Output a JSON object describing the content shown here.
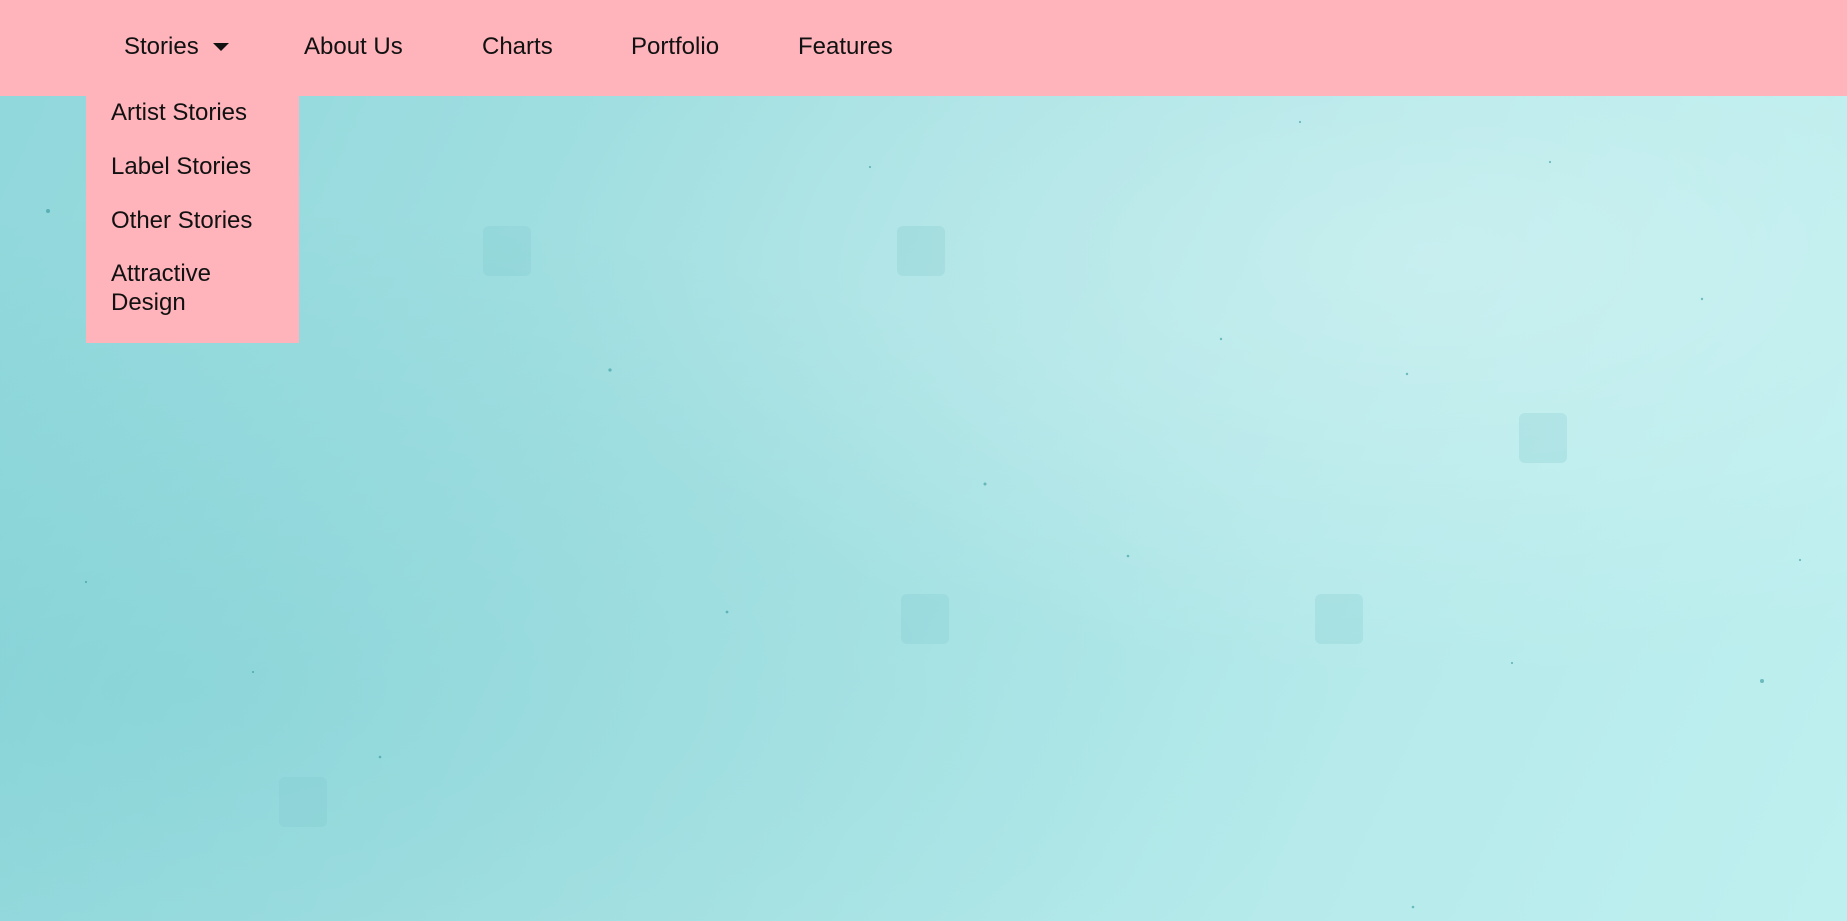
{
  "nav": {
    "items": [
      {
        "label": "Stories",
        "has_dropdown": true
      },
      {
        "label": "About Us"
      },
      {
        "label": "Charts"
      },
      {
        "label": "Portfolio"
      },
      {
        "label": "Features"
      }
    ],
    "dropdown": {
      "open_under": "Stories",
      "items": [
        {
          "label": "Artist Stories"
        },
        {
          "label": "Label Stories"
        },
        {
          "label": "Other Stories"
        },
        {
          "label": "Attractive Design"
        }
      ]
    }
  },
  "colors": {
    "nav_background": "#ffb3bb",
    "page_background": "#a6e1e3",
    "text": "#111111"
  },
  "icons": {
    "dropdown_caret": "caret-down-icon"
  }
}
